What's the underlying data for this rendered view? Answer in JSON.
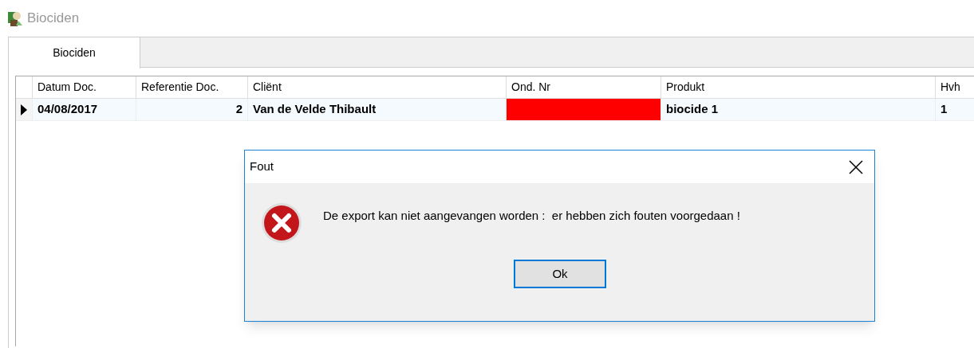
{
  "window": {
    "title": "Biociden"
  },
  "tabs": [
    {
      "label": "Biociden",
      "selected": true
    }
  ],
  "table": {
    "columns": [
      "Datum Doc.",
      "Referentie Doc.",
      "Cliënt",
      "Ond. Nr",
      "Produkt",
      "Hvh"
    ],
    "rows": [
      {
        "selected": true,
        "cells": [
          {
            "kind": "text",
            "text": "04/08/2017"
          },
          {
            "kind": "number",
            "text": "2"
          },
          {
            "kind": "text",
            "text": "Van de Velde Thibault"
          },
          {
            "kind": "swatch",
            "color": "#ff0000"
          },
          {
            "kind": "text",
            "text": "biocide 1"
          },
          {
            "kind": "text",
            "text": "1"
          }
        ]
      }
    ]
  },
  "dialog": {
    "title": "Fout",
    "message": "De export kan niet aangevangen worden :  er hebben zich fouten voorgedaan !",
    "buttons": [
      "Ok"
    ]
  }
}
